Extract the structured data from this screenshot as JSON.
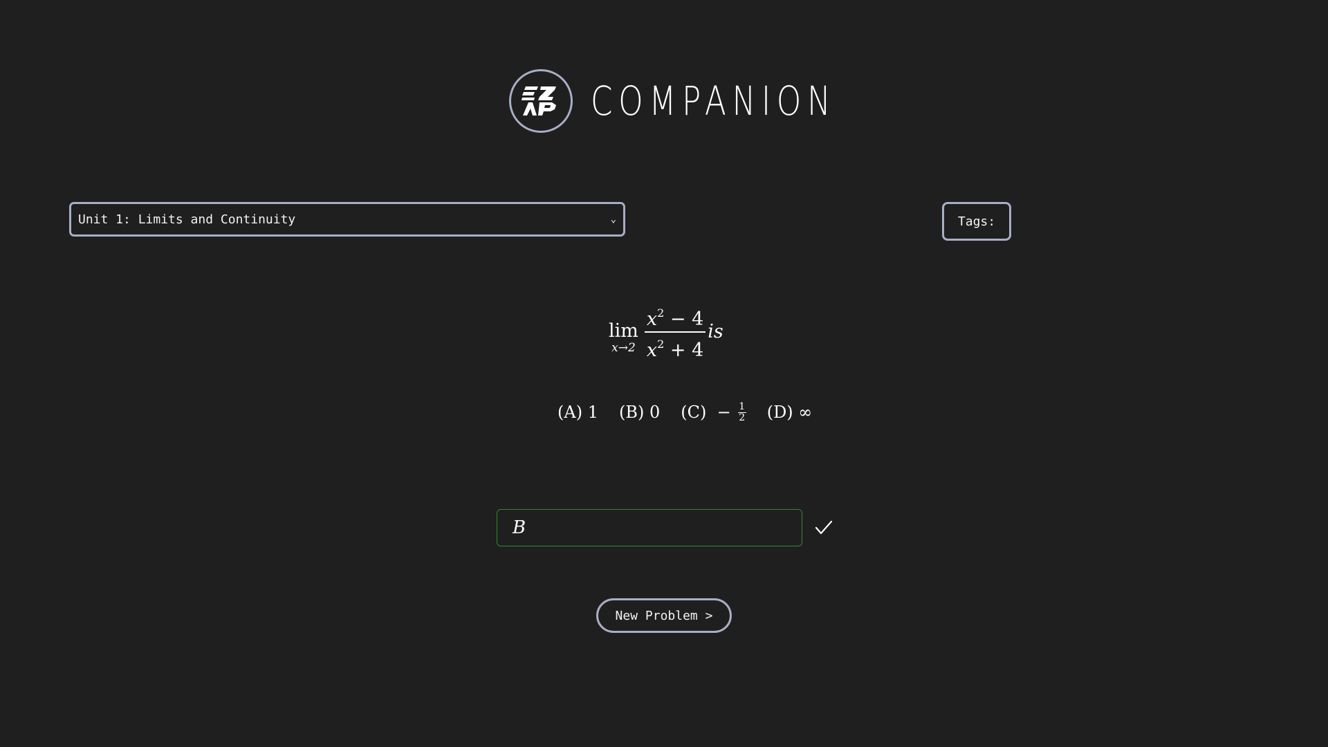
{
  "header": {
    "logo_text": "EZ AP",
    "title": "COMPANION"
  },
  "unit_select": {
    "selected": "Unit 1: Limits and Continuity",
    "icon": "chevron-down-icon"
  },
  "tags": {
    "label": "Tags:"
  },
  "question": {
    "lim": "lim",
    "lim_sub": "x→2",
    "numerator_var": "x",
    "numerator_exp": "2",
    "numerator_rest": " − 4",
    "denominator_var": "x",
    "denominator_exp": "2",
    "denominator_rest": " + 4",
    "trailing": "is"
  },
  "choices": {
    "a": "(A) 1",
    "b": "(B) 0",
    "c": "(C)  −",
    "c_num": "1",
    "c_den": "2",
    "d": "(D) ∞"
  },
  "answer": {
    "value": "B",
    "status_icon": "checkmark-icon"
  },
  "new_problem": {
    "label": "New Problem >"
  },
  "colors": {
    "background": "#1f1f1f",
    "border": "#a9aec6",
    "correct": "#2e8b2e",
    "text": "#ffffff"
  }
}
